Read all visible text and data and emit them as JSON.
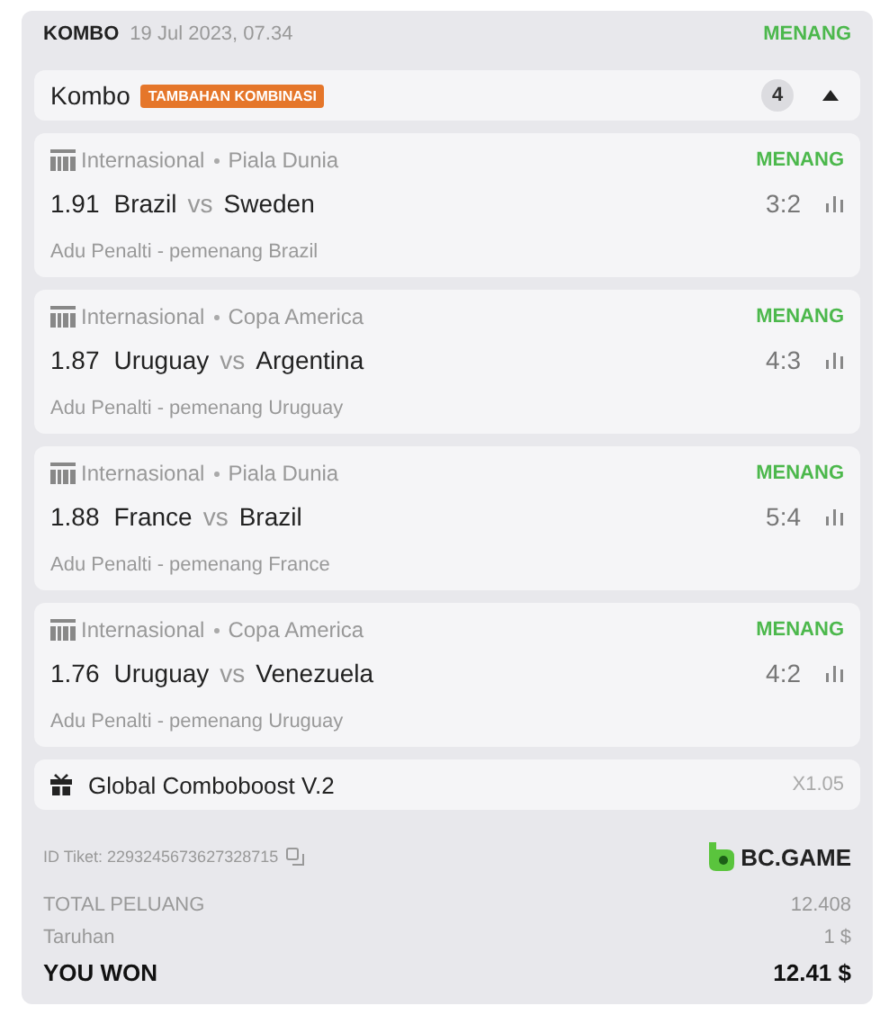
{
  "header": {
    "type": "KOMBO",
    "date": "19 Jul 2023, 07.34",
    "status": "MENANG"
  },
  "combo_bar": {
    "label": "Kombo",
    "badge": "TAMBAHAN KOMBINASI",
    "count": "4",
    "expanded": true
  },
  "matches": [
    {
      "league": "Internasional",
      "tournament": "Piala Dunia",
      "status": "MENANG",
      "odds": "1.91",
      "home": "Brazil",
      "vs": "vs",
      "away": "Sweden",
      "score": "3:2",
      "market": "Adu Penalti - pemenang Brazil"
    },
    {
      "league": "Internasional",
      "tournament": "Copa America",
      "status": "MENANG",
      "odds": "1.87",
      "home": "Uruguay",
      "vs": "vs",
      "away": "Argentina",
      "score": "4:3",
      "market": "Adu Penalti - pemenang Uruguay"
    },
    {
      "league": "Internasional",
      "tournament": "Piala Dunia",
      "status": "MENANG",
      "odds": "1.88",
      "home": "France",
      "vs": "vs",
      "away": "Brazil",
      "score": "5:4",
      "market": "Adu Penalti - pemenang France"
    },
    {
      "league": "Internasional",
      "tournament": "Copa America",
      "status": "MENANG",
      "odds": "1.76",
      "home": "Uruguay",
      "vs": "vs",
      "away": "Venezuela",
      "score": "4:2",
      "market": "Adu Penalti - pemenang Uruguay"
    }
  ],
  "boost": {
    "label": "Global Comboboost V.2",
    "multiplier": "X1.05"
  },
  "ticket": {
    "id": "ID Tiket: 2293245673627328715",
    "brand": "BC.GAME"
  },
  "summary": [
    {
      "kind": "muted",
      "label": "TOTAL PELUANG",
      "value": "12.408"
    },
    {
      "kind": "normal",
      "label": "Taruhan",
      "value": "1 $"
    },
    {
      "kind": "total",
      "label": "YOU WON",
      "value": "12.41 $"
    }
  ]
}
